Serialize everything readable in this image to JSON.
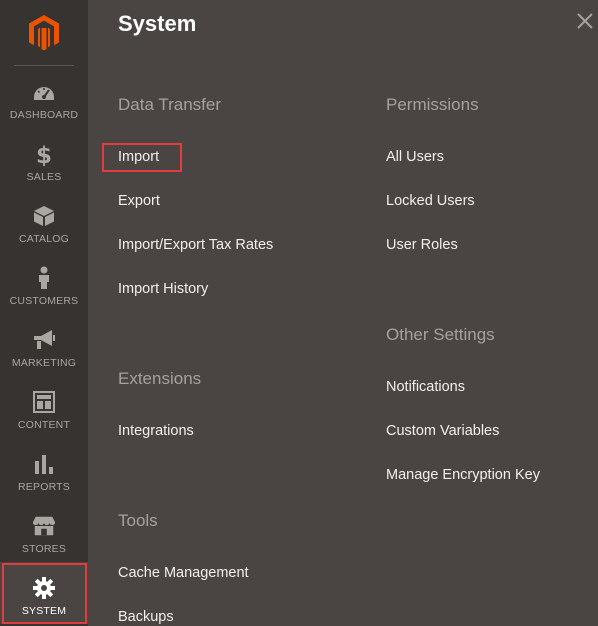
{
  "brand": {
    "logo_icon": "magento-logo-icon",
    "accent": "#eb5202",
    "highlight": "#e03e3e"
  },
  "sidebar": {
    "items": [
      {
        "label": "DASHBOARD",
        "icon": "speedometer-icon"
      },
      {
        "label": "SALES",
        "icon": "dollar-icon"
      },
      {
        "label": "CATALOG",
        "icon": "cube-icon"
      },
      {
        "label": "CUSTOMERS",
        "icon": "person-icon"
      },
      {
        "label": "MARKETING",
        "icon": "megaphone-icon"
      },
      {
        "label": "CONTENT",
        "icon": "layout-icon"
      },
      {
        "label": "REPORTS",
        "icon": "bar-chart-icon"
      },
      {
        "label": "STORES",
        "icon": "storefront-icon"
      },
      {
        "label": "SYSTEM",
        "icon": "gear-icon"
      }
    ]
  },
  "panel": {
    "title": "System",
    "close_icon": "close-icon",
    "sections": {
      "data_transfer": {
        "title": "Data Transfer",
        "links": [
          "Import",
          "Export",
          "Import/Export Tax Rates",
          "Import History"
        ]
      },
      "extensions": {
        "title": "Extensions",
        "links": [
          "Integrations"
        ]
      },
      "tools": {
        "title": "Tools",
        "links": [
          "Cache Management",
          "Backups"
        ]
      },
      "permissions": {
        "title": "Permissions",
        "links": [
          "All Users",
          "Locked Users",
          "User Roles"
        ]
      },
      "other_settings": {
        "title": "Other Settings",
        "links": [
          "Notifications",
          "Custom Variables",
          "Manage Encryption Key"
        ]
      }
    }
  }
}
